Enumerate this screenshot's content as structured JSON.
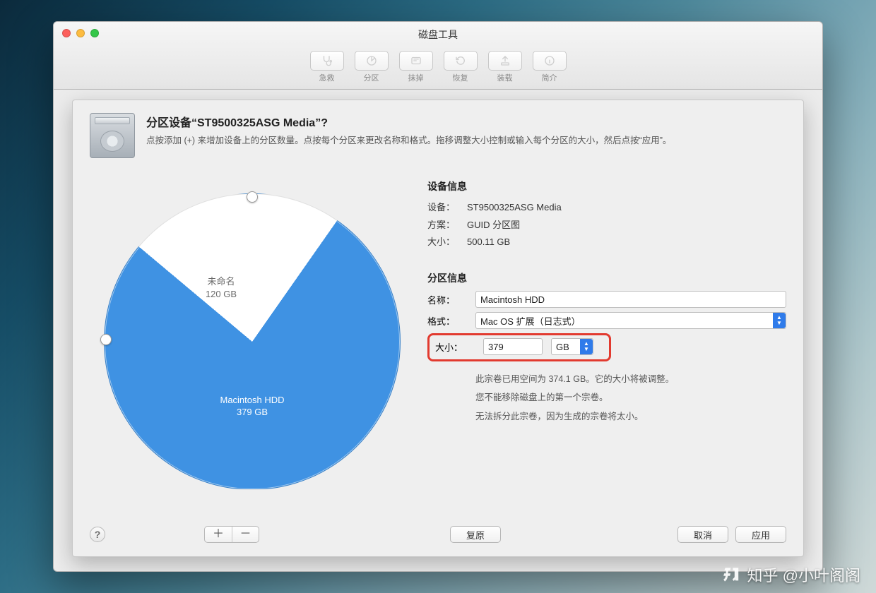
{
  "window": {
    "title": "磁盘工具"
  },
  "toolbar": [
    {
      "label": "急救"
    },
    {
      "label": "分区"
    },
    {
      "label": "抹掉"
    },
    {
      "label": "恢复"
    },
    {
      "label": "装载"
    },
    {
      "label": "简介"
    }
  ],
  "sheet": {
    "heading": "分区设备“ST9500325ASG Media”?",
    "desc": "点按添加 (+) 来增加设备上的分区数量。点按每个分区来更改名称和格式。拖移调整大小控制或输入每个分区的大小，然后点按“应用”。"
  },
  "device_info": {
    "title": "设备信息",
    "device_label": "设备",
    "device_value": "ST9500325ASG Media",
    "scheme_label": "方案",
    "scheme_value": "GUID 分区图",
    "size_label": "大小",
    "size_value": "500.11 GB"
  },
  "partition_info": {
    "title": "分区信息",
    "name_label": "名称",
    "name_value": "Macintosh HDD",
    "format_label": "格式",
    "format_value": "Mac OS 扩展（日志式）",
    "size_label": "大小",
    "size_value": "379",
    "size_unit": "GB",
    "notes": [
      "此宗卷已用空间为 374.1 GB。它的大小将被调整。",
      "您不能移除磁盘上的第一个宗卷。",
      "无法拆分此宗卷，因为生成的宗卷将太小。"
    ]
  },
  "pie": {
    "slice1_name": "未命名",
    "slice1_size": "120 GB",
    "slice2_name": "Macintosh HDD",
    "slice2_size": "379 GB"
  },
  "footer": {
    "revert": "复原",
    "cancel": "取消",
    "apply": "应用"
  },
  "watermark": "知乎 @小叶阁阁",
  "chart_data": {
    "type": "pie",
    "title": "分区设备 ST9500325ASG Media",
    "series": [
      {
        "name": "未命名",
        "value_gb": 120
      },
      {
        "name": "Macintosh HDD",
        "value_gb": 379
      }
    ],
    "total_gb": 500.11
  }
}
